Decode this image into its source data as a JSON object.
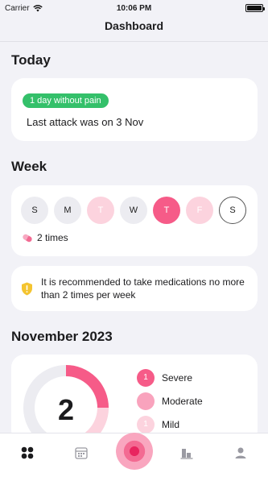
{
  "status": {
    "carrier": "Carrier",
    "time": "10:06 PM"
  },
  "nav": {
    "title": "Dashboard"
  },
  "today": {
    "title": "Today",
    "badge": "1 day without pain",
    "last_attack": "Last attack was on 3 Nov"
  },
  "week": {
    "title": "Week",
    "days": [
      {
        "label": "S",
        "state": "none"
      },
      {
        "label": "M",
        "state": "none"
      },
      {
        "label": "T",
        "state": "light"
      },
      {
        "label": "W",
        "state": "none"
      },
      {
        "label": "T",
        "state": "strong"
      },
      {
        "label": "F",
        "state": "light"
      },
      {
        "label": "S",
        "state": "today"
      }
    ],
    "times": "2 times"
  },
  "tip": {
    "text": "It is recommended to take medications no more than 2 times per week"
  },
  "month": {
    "title": "November 2023",
    "count": "2",
    "legend": [
      {
        "label": "Severe",
        "badge": "1",
        "color": "#f65b88"
      },
      {
        "label": "Moderate",
        "badge": "",
        "color": "#f9a3bd"
      },
      {
        "label": "Mild",
        "badge": "1",
        "color": "#fcd3de"
      }
    ]
  },
  "colors": {
    "accent": "#f65b88",
    "success": "#34c06a",
    "warning": "#f4c430",
    "background": "#f2f2f7"
  }
}
